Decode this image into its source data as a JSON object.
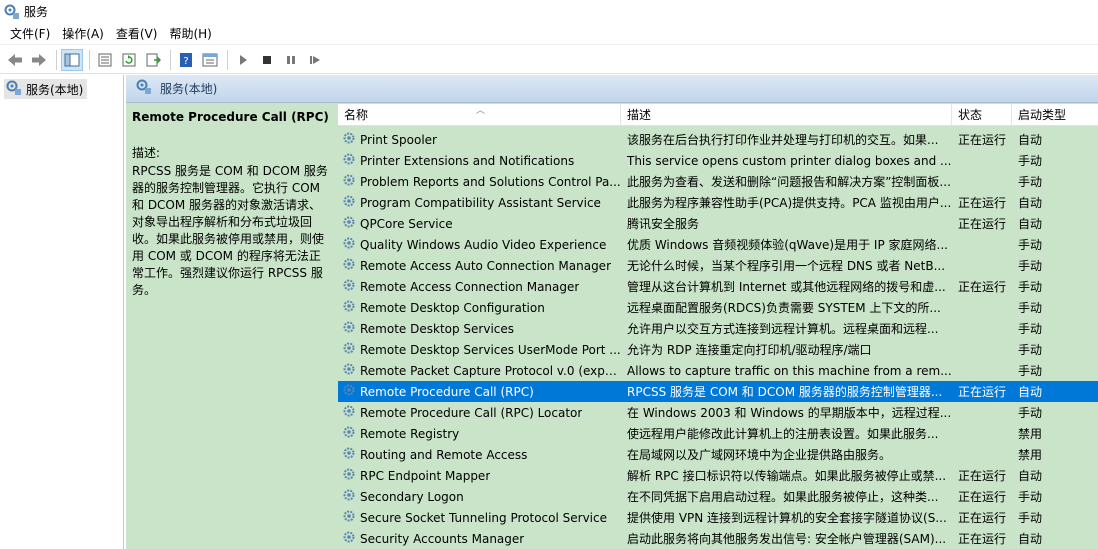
{
  "window": {
    "title": "服务"
  },
  "menu": [
    {
      "label": "文件(F)",
      "name": "menu-file"
    },
    {
      "label": "操作(A)",
      "name": "menu-action"
    },
    {
      "label": "查看(V)",
      "name": "menu-view"
    },
    {
      "label": "帮助(H)",
      "name": "menu-help"
    }
  ],
  "tree": {
    "root_label": "服务(本地)"
  },
  "content_header": {
    "label": "服务(本地)"
  },
  "description": {
    "title": "Remote Procedure Call (RPC)",
    "label": "描述:",
    "text": "RPCSS 服务是 COM 和 DCOM 服务器的服务控制管理器。它执行 COM 和 DCOM 服务器的对象激活请求、对象导出程序解析和分布式垃圾回收。如果此服务被停用或禁用，则使用 COM 或 DCOM 的程序将无法正常工作。强烈建议你运行 RPCSS 服务。"
  },
  "columns": {
    "name": "名称",
    "desc": "描述",
    "status": "状态",
    "startup": "启动类型"
  },
  "colors": {
    "selected": "#0078d7",
    "pane_bg": "#c9e4c9"
  },
  "services": [
    {
      "name": "Print Spooler",
      "desc": "该服务在后台执行打印作业并处理与打印机的交互。如果...",
      "status": "正在运行",
      "startup": "自动"
    },
    {
      "name": "Printer Extensions and Notifications",
      "desc": "This service opens custom printer dialog boxes and ...",
      "status": "",
      "startup": "手动"
    },
    {
      "name": "Problem Reports and Solutions Control Pa...",
      "desc": "此服务为查看、发送和删除“问题报告和解决方案”控制面板...",
      "status": "",
      "startup": "手动"
    },
    {
      "name": "Program Compatibility Assistant Service",
      "desc": "此服务为程序兼容性助手(PCA)提供支持。PCA 监视由用户...",
      "status": "正在运行",
      "startup": "自动"
    },
    {
      "name": "QPCore Service",
      "desc": "腾讯安全服务",
      "status": "正在运行",
      "startup": "自动"
    },
    {
      "name": "Quality Windows Audio Video Experience",
      "desc": "优质 Windows 音频视频体验(qWave)是用于 IP 家庭网络...",
      "status": "",
      "startup": "手动"
    },
    {
      "name": "Remote Access Auto Connection Manager",
      "desc": "无论什么时候，当某个程序引用一个远程 DNS 或者 NetB...",
      "status": "",
      "startup": "手动"
    },
    {
      "name": "Remote Access Connection Manager",
      "desc": "管理从这台计算机到 Internet 或其他远程网络的拨号和虚...",
      "status": "正在运行",
      "startup": "手动"
    },
    {
      "name": "Remote Desktop Configuration",
      "desc": "远程桌面配置服务(RDCS)负责需要 SYSTEM 上下文的所...",
      "status": "",
      "startup": "手动"
    },
    {
      "name": "Remote Desktop Services",
      "desc": "允许用户以交互方式连接到远程计算机。远程桌面和远程...",
      "status": "",
      "startup": "手动"
    },
    {
      "name": "Remote Desktop Services UserMode Port ...",
      "desc": "允许为 RDP 连接重定向打印机/驱动程序/端口",
      "status": "",
      "startup": "手动"
    },
    {
      "name": "Remote Packet Capture Protocol v.0 (expe...",
      "desc": "Allows to capture traffic on this machine from a rem...",
      "status": "",
      "startup": "手动"
    },
    {
      "name": "Remote Procedure Call (RPC)",
      "desc": "RPCSS 服务是 COM 和 DCOM 服务器的服务控制管理器...",
      "status": "正在运行",
      "startup": "自动",
      "selected": true
    },
    {
      "name": "Remote Procedure Call (RPC) Locator",
      "desc": "在 Windows 2003 和 Windows 的早期版本中，远程过程...",
      "status": "",
      "startup": "手动"
    },
    {
      "name": "Remote Registry",
      "desc": "使远程用户能修改此计算机上的注册表设置。如果此服务...",
      "status": "",
      "startup": "禁用"
    },
    {
      "name": "Routing and Remote Access",
      "desc": "在局域网以及广域网环境中为企业提供路由服务。",
      "status": "",
      "startup": "禁用"
    },
    {
      "name": "RPC Endpoint Mapper",
      "desc": "解析 RPC 接口标识符以传输端点。如果此服务被停止或禁...",
      "status": "正在运行",
      "startup": "自动"
    },
    {
      "name": "Secondary Logon",
      "desc": "在不同凭据下启用启动过程。如果此服务被停止，这种类...",
      "status": "正在运行",
      "startup": "手动"
    },
    {
      "name": "Secure Socket Tunneling Protocol Service",
      "desc": "提供使用 VPN 连接到远程计算机的安全套接字隧道协议(S...",
      "status": "正在运行",
      "startup": "手动"
    },
    {
      "name": "Security Accounts Manager",
      "desc": "启动此服务将向其他服务发出信号: 安全帐户管理器(SAM)...",
      "status": "正在运行",
      "startup": "自动"
    }
  ]
}
